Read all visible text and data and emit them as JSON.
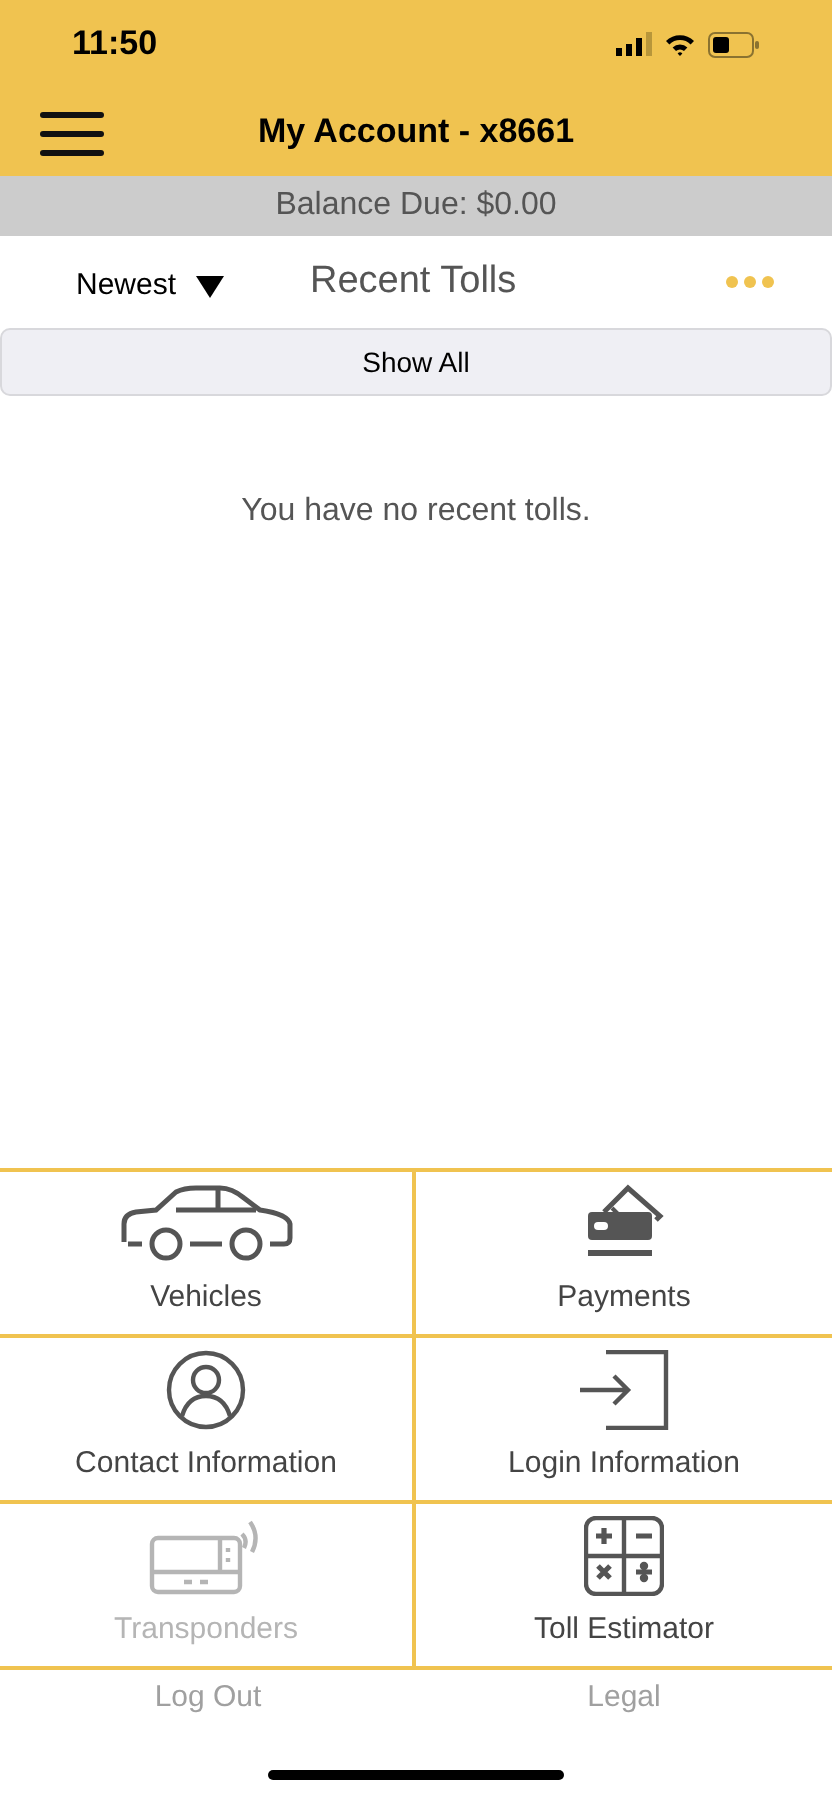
{
  "status_bar": {
    "time": "11:50"
  },
  "header": {
    "title": "My Account - x8661"
  },
  "balance": {
    "text": "Balance Due: $0.00"
  },
  "tolls": {
    "sort": "Newest",
    "title": "Recent Tolls",
    "show_all": "Show All",
    "empty_message": "You have no recent tolls."
  },
  "tiles": [
    {
      "kind": "car",
      "label": "Vehicles",
      "disabled": false
    },
    {
      "kind": "card",
      "label": "Payments",
      "disabled": false
    },
    {
      "kind": "person",
      "label": "Contact Information",
      "disabled": false
    },
    {
      "kind": "login",
      "label": "Login Information",
      "disabled": false
    },
    {
      "kind": "transponder",
      "label": "Transponders",
      "disabled": true
    },
    {
      "kind": "calculator",
      "label": "Toll Estimator",
      "disabled": false
    }
  ],
  "footer_links": [
    "Log Out",
    "Legal"
  ]
}
